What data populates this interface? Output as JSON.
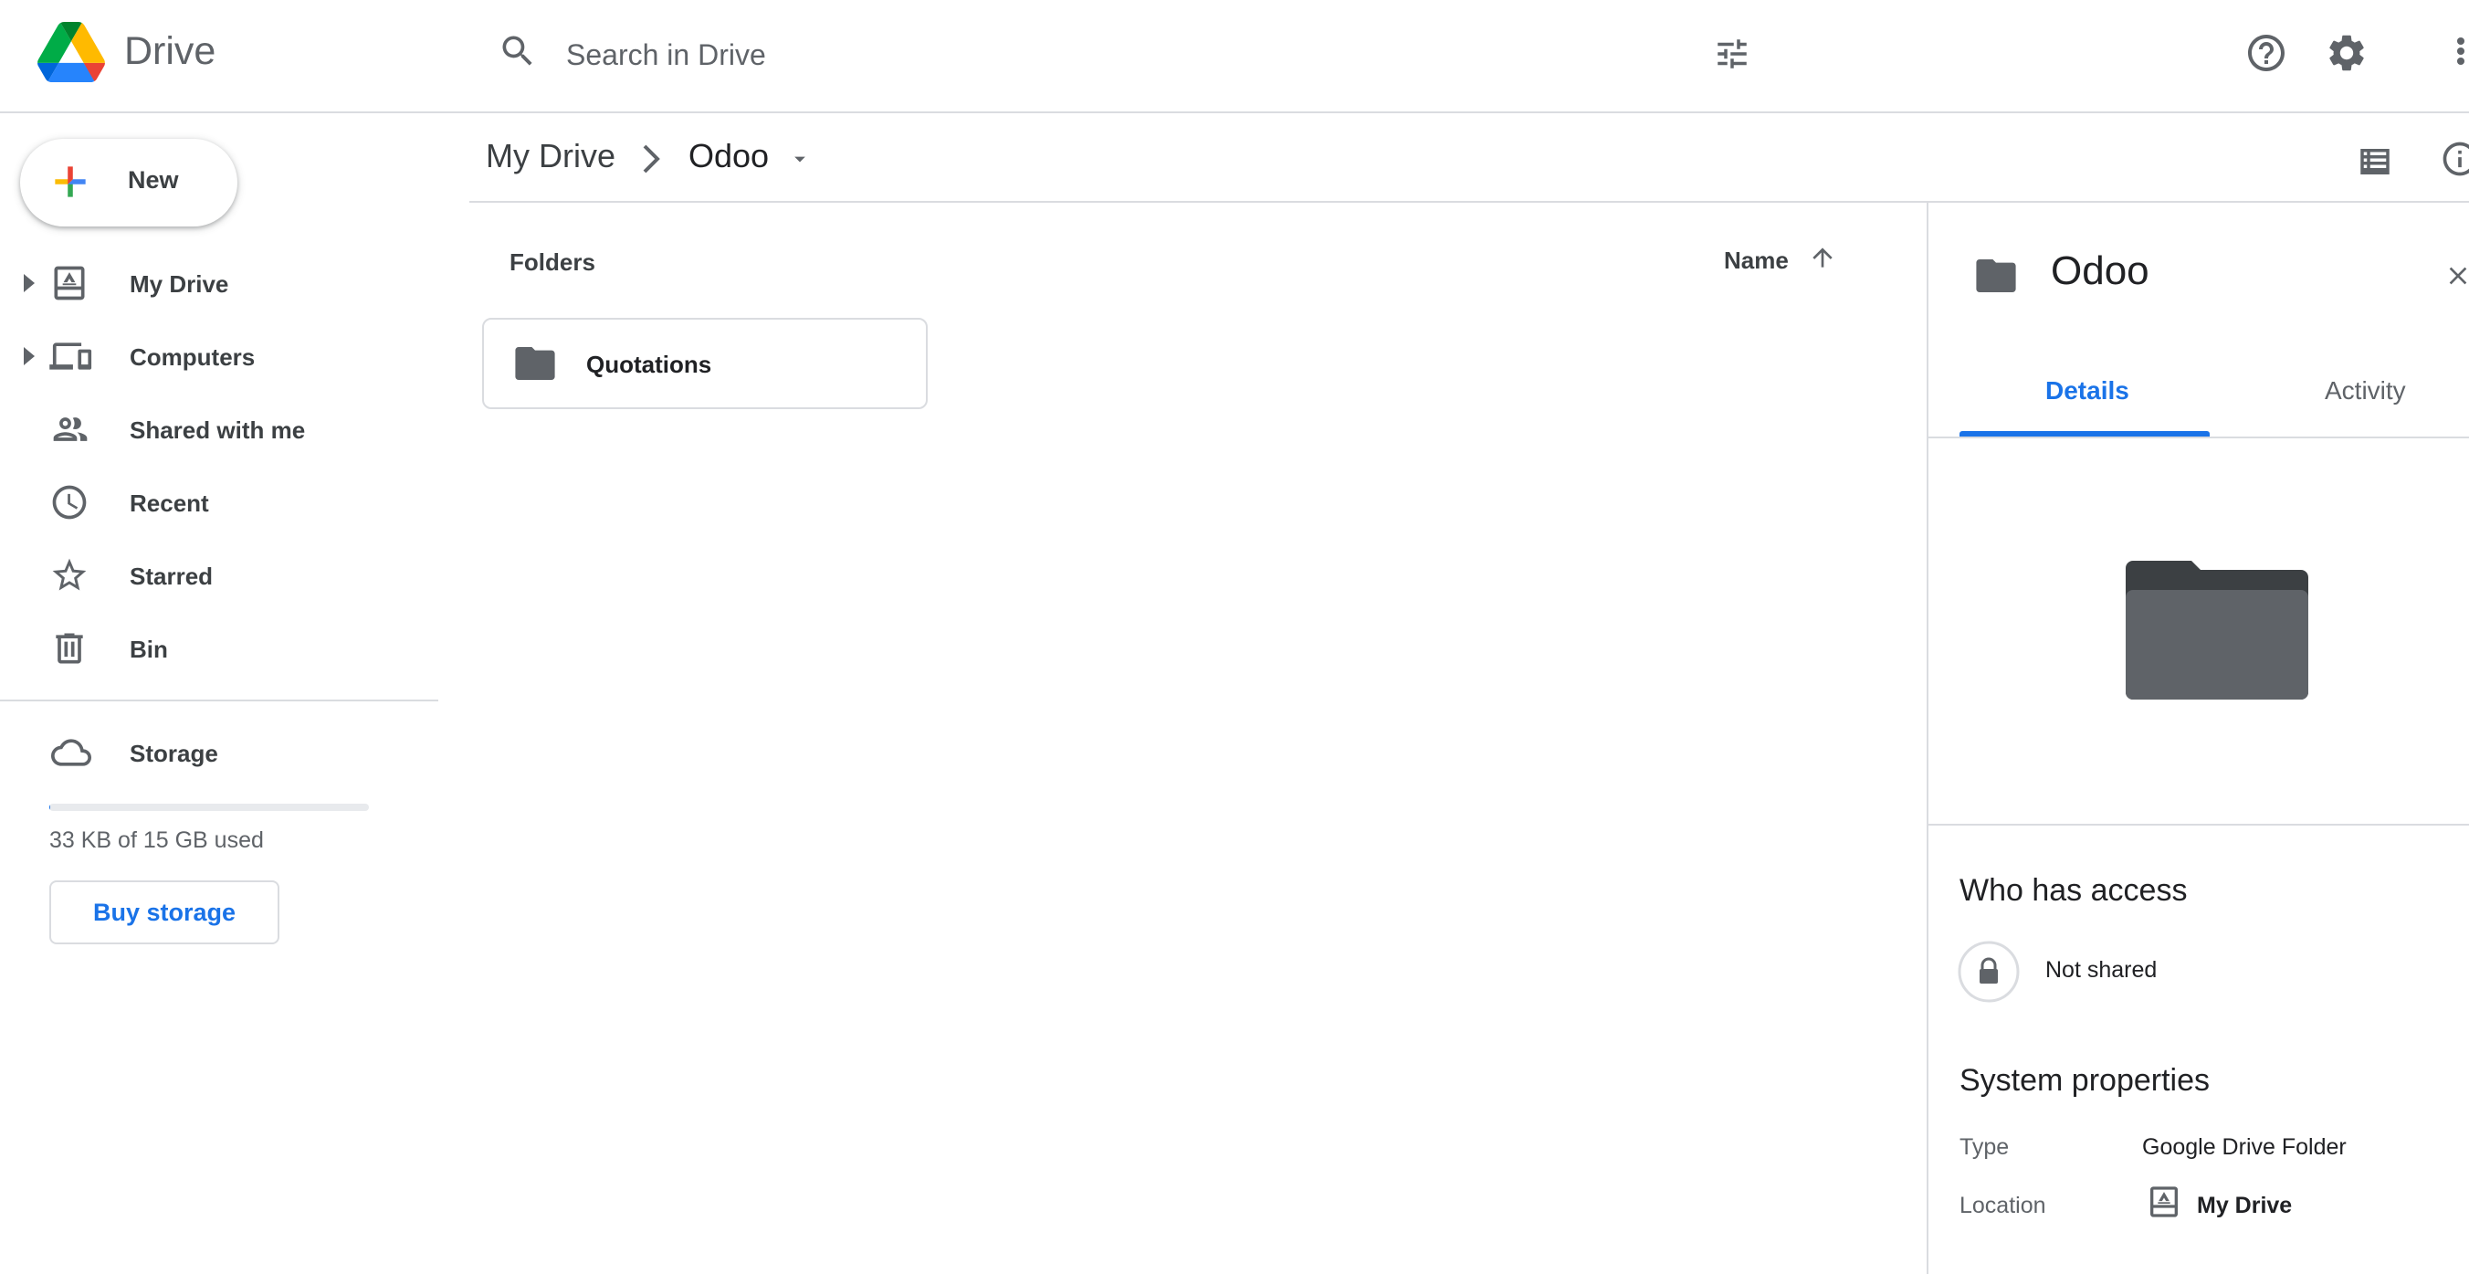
{
  "header": {
    "app_name": "Drive",
    "search_placeholder": "Search in Drive",
    "icons": [
      "drive-logo",
      "search-icon",
      "tune-icon",
      "help-icon",
      "gear-icon",
      "apps-icon"
    ]
  },
  "sidebar": {
    "new_label": "New",
    "items": [
      {
        "label": "My Drive",
        "icon": "my-drive-icon",
        "expandable": true
      },
      {
        "label": "Computers",
        "icon": "computers-icon",
        "expandable": true
      },
      {
        "label": "Shared with me",
        "icon": "people-icon",
        "expandable": false
      },
      {
        "label": "Recent",
        "icon": "clock-icon",
        "expandable": false
      },
      {
        "label": "Starred",
        "icon": "star-icon",
        "expandable": false
      },
      {
        "label": "Bin",
        "icon": "trash-icon",
        "expandable": false
      }
    ],
    "storage": {
      "label": "Storage",
      "usage_text": "33 KB of 15 GB used",
      "used_fraction": 0.002,
      "buy_label": "Buy storage"
    }
  },
  "main": {
    "breadcrumb": {
      "root": "My Drive",
      "current": "Odoo"
    },
    "folders_label": "Folders",
    "sort_label": "Name",
    "folders": [
      {
        "name": "Quotations"
      }
    ]
  },
  "details": {
    "title": "Odoo",
    "tabs": [
      {
        "label": "Details",
        "active": true
      },
      {
        "label": "Activity",
        "active": false
      }
    ],
    "access_title": "Who has access",
    "access_status": "Not shared",
    "properties_title": "System properties",
    "properties": {
      "type_label": "Type",
      "type_value": "Google Drive Folder",
      "location_label": "Location",
      "location_value": "My Drive"
    }
  },
  "colors": {
    "accent": "#1a73e8",
    "icon_gray": "#5f6368",
    "border": "#dadce0",
    "folder_dark": "#5f6368"
  }
}
